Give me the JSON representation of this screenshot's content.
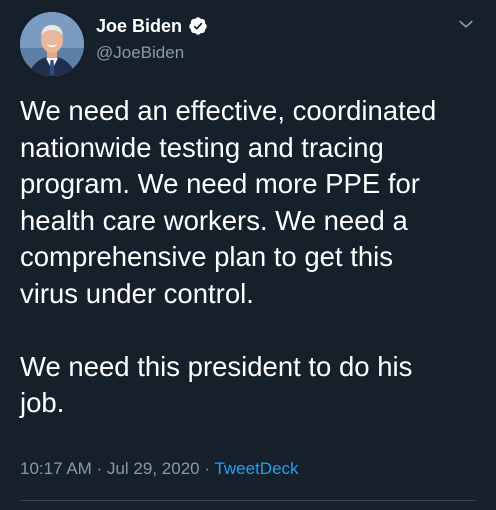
{
  "author": {
    "name": "Joe Biden",
    "handle": "@JoeBiden",
    "verified": true
  },
  "tweet": {
    "text": "We need an effective, coordinated\nnationwide testing and tracing\nprogram. We need more PPE for\nhealth care workers. We need a\ncomprehensive plan to get this\nvirus under control.\n\nWe need this president to do his\njob.",
    "time": "10:17 AM",
    "separator": "·",
    "date": "Jul 29, 2020",
    "source": "TweetDeck"
  },
  "icons": {
    "verified": "verified-badge-icon",
    "more": "chevron-down-icon"
  },
  "colors": {
    "background": "#15202b",
    "text": "#ffffff",
    "muted": "#8899a6",
    "link": "#1da1f2",
    "divider": "#38444d"
  }
}
